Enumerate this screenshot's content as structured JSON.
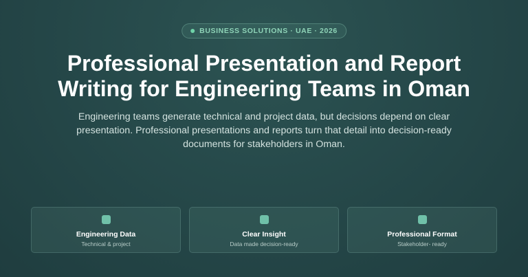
{
  "badge": {
    "text": "BUSINESS SOLUTIONS · UAE · 2026"
  },
  "hero": {
    "title_line1": "Professional Presentation and Report",
    "title_line2": "Writing for Engineering Teams in Oman",
    "subtitle": "Engineering teams generate technical and project data, but decisions depend on clear presentation. Professional presentations and reports turn that detail into decision-ready documents for stakeholders in Oman."
  },
  "cards": [
    {
      "title": "Engineering Data",
      "subtitle": "Technical & project",
      "icon": "square-icon"
    },
    {
      "title": "Clear Insight",
      "subtitle": "Data made decision-ready",
      "icon": "square-icon"
    },
    {
      "title": "Professional Format",
      "subtitle": "Stakeholder- ready",
      "icon": "square-icon"
    }
  ],
  "colors": {
    "accent": "#6fd3a8",
    "background": "#26494a"
  }
}
